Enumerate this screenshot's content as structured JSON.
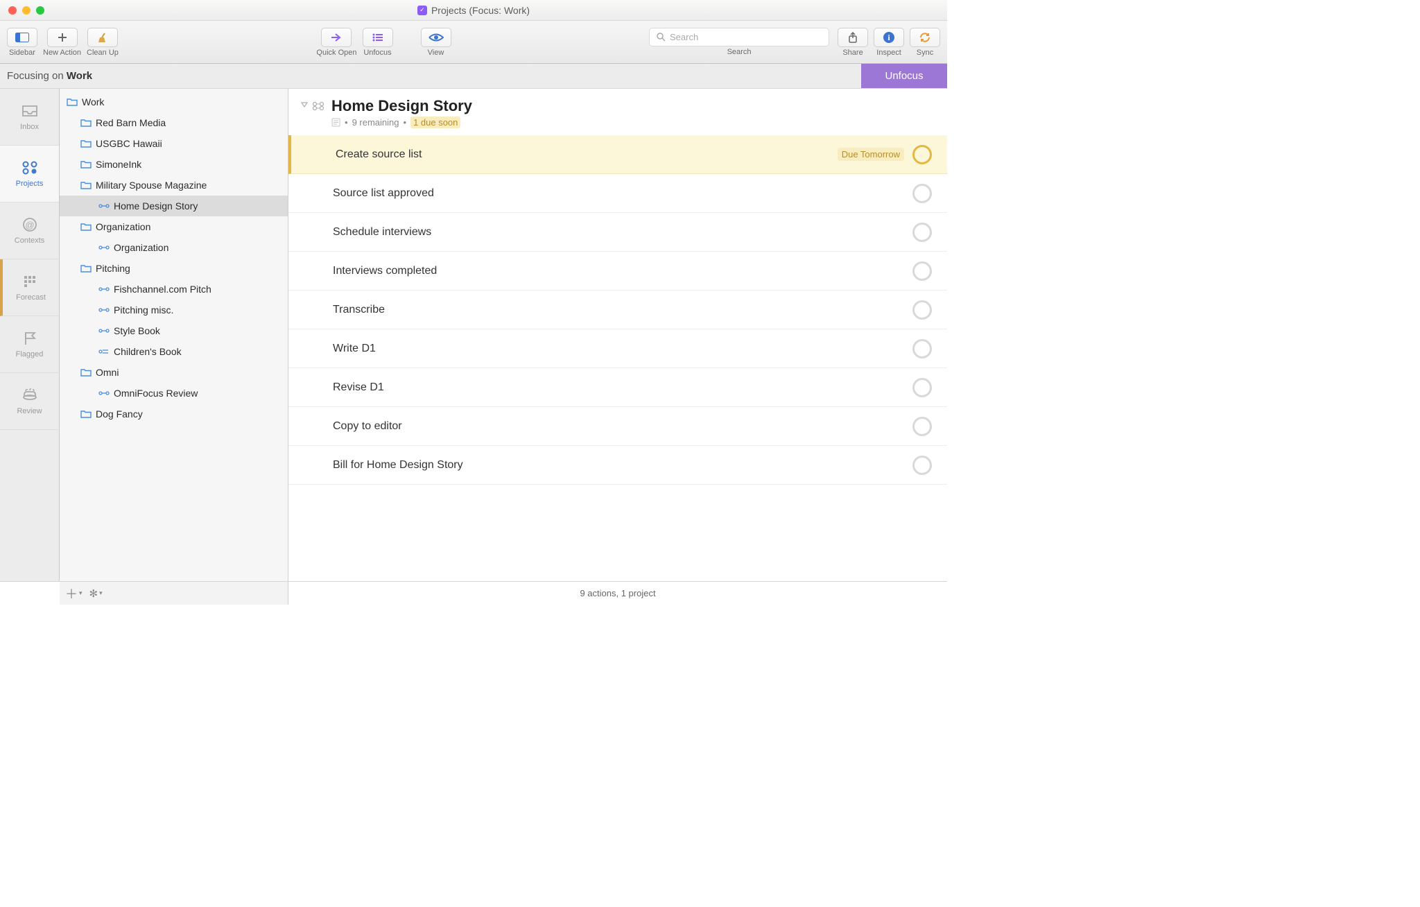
{
  "window_title": "Projects (Focus: Work)",
  "toolbar": {
    "sidebar": "Sidebar",
    "new_action": "New Action",
    "clean_up": "Clean Up",
    "quick_open": "Quick Open",
    "unfocus": "Unfocus",
    "view": "View",
    "search_placeholder": "Search",
    "search_label": "Search",
    "share": "Share",
    "inspect": "Inspect",
    "sync": "Sync"
  },
  "focus": {
    "prefix": "Focusing on ",
    "target": "Work",
    "unfocus_btn": "Unfocus"
  },
  "perspectives": {
    "items": [
      {
        "label": "Inbox"
      },
      {
        "label": "Projects"
      },
      {
        "label": "Contexts"
      },
      {
        "label": "Forecast"
      },
      {
        "label": "Flagged"
      },
      {
        "label": "Review"
      }
    ]
  },
  "sidebar": {
    "tree": [
      {
        "label": "Work",
        "type": "folder",
        "indent": 0
      },
      {
        "label": "Red Barn Media",
        "type": "folder",
        "indent": 1
      },
      {
        "label": "USGBC Hawaii",
        "type": "folder",
        "indent": 1
      },
      {
        "label": "SimoneInk",
        "type": "folder",
        "indent": 1
      },
      {
        "label": "Military Spouse Magazine",
        "type": "folder",
        "indent": 1
      },
      {
        "label": "Home Design Story",
        "type": "project-seq",
        "indent": 2,
        "selected": true
      },
      {
        "label": "Organization",
        "type": "folder",
        "indent": 1
      },
      {
        "label": "Organization",
        "type": "project-seq",
        "indent": 2
      },
      {
        "label": "Pitching",
        "type": "folder",
        "indent": 1
      },
      {
        "label": "Fishchannel.com Pitch",
        "type": "project-seq",
        "indent": 2
      },
      {
        "label": "Pitching misc.",
        "type": "project-seq",
        "indent": 2
      },
      {
        "label": "Style Book",
        "type": "project-seq",
        "indent": 2
      },
      {
        "label": "Children's Book",
        "type": "project-single",
        "indent": 2
      },
      {
        "label": "Omni",
        "type": "folder",
        "indent": 1
      },
      {
        "label": "OmniFocus Review",
        "type": "project-seq",
        "indent": 2
      },
      {
        "label": "Dog Fancy",
        "type": "folder",
        "indent": 1
      }
    ]
  },
  "content": {
    "title": "Home Design Story",
    "remaining": "9 remaining",
    "due_soon": "1 due soon",
    "tasks": [
      {
        "label": "Create source list",
        "due": "Due Tomorrow",
        "highlight": true
      },
      {
        "label": "Source list approved"
      },
      {
        "label": "Schedule interviews"
      },
      {
        "label": "Interviews completed"
      },
      {
        "label": "Transcribe"
      },
      {
        "label": "Write D1"
      },
      {
        "label": "Revise D1"
      },
      {
        "label": "Copy to editor"
      },
      {
        "label": "Bill for Home Design Story"
      }
    ]
  },
  "status": {
    "summary": "9 actions, 1 project"
  }
}
